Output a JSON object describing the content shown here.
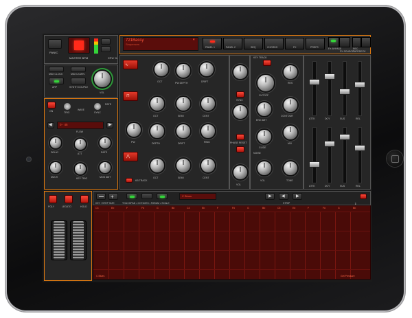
{
  "header": {
    "preset_name": "721Bassy",
    "preset_sub": "Sequences",
    "tabs": [
      "PANEL 1",
      "PANEL 2",
      "SEQ",
      "CHORDS",
      "FX",
      "PREFS"
    ],
    "right_buttons": [
      "FX BYPASS",
      "FX SOURCE",
      "REC",
      "TAPEDECK"
    ],
    "left_labels": {
      "panic": "PANIC",
      "master_bpm": "MASTER BPM",
      "cpu": "CPU %"
    }
  },
  "left_panel": {
    "buttons": [
      "MIDI CLOCK",
      "MIDI LEARN",
      "ARP",
      "SYNTH COUPLE"
    ],
    "knob_label": "VOL",
    "mod_labels": [
      "ON",
      "TRIG",
      "WAVE",
      "RATE",
      "SYNC"
    ],
    "flow_label": "FLOW",
    "flow_display": "0 - 45",
    "env_labels": [
      "DELAY",
      "ATT",
      "RATE",
      "MULTI",
      "GAIN",
      "KEY TRIG",
      "SRC",
      "MOD AMT"
    ]
  },
  "osc": {
    "row1": [
      "OCT",
      "PW",
      "PW DEPTH",
      "DRIFT"
    ],
    "row2": [
      "OCT",
      "SEMI",
      "CENT",
      "PW",
      "DEPTH",
      "DRIFT",
      "RING"
    ],
    "row3": [
      "OCT",
      "SEMI",
      "CENT"
    ],
    "labels": [
      "OSC 1",
      "OSC 2",
      "OSC 3",
      "SYNC",
      "PHASE RESET",
      "KB TRACK"
    ]
  },
  "filter": {
    "labels": [
      "KEY TRACK",
      "CUTOFF",
      "RES",
      "ENV AMT",
      "CONTOUR",
      "KEY",
      "GLIDE",
      "MIX",
      "NOISE",
      "VOL",
      "TONE"
    ]
  },
  "envelope": {
    "labels": [
      "ATTK",
      "DCY",
      "SUS",
      "REL"
    ]
  },
  "performance": {
    "toggles": [
      "POLY",
      "LEGATO",
      "HOLD"
    ]
  },
  "sequencer": {
    "toolbar_label": "KEY / STEP SIZE",
    "submenu": "TOUCHPAD • OCTAVES • PARAM • SCALE",
    "strip": "STRIP",
    "scale_display": "C Blues",
    "notes": [
      "C3",
      "Eb",
      "F",
      "F#",
      "G",
      "Bb",
      "C4",
      "Eb",
      "F",
      "F#",
      "G",
      "Bb",
      "C5",
      "Eb",
      "F",
      "F#",
      "G",
      "Bb"
    ],
    "footer_left": "C Blues",
    "footer_right": "Get Pressure"
  },
  "colors": {
    "accent": "#e07a10",
    "led_red": "#ff2a1a",
    "led_green": "#34d43a",
    "keyboard": "#4a0b08"
  }
}
